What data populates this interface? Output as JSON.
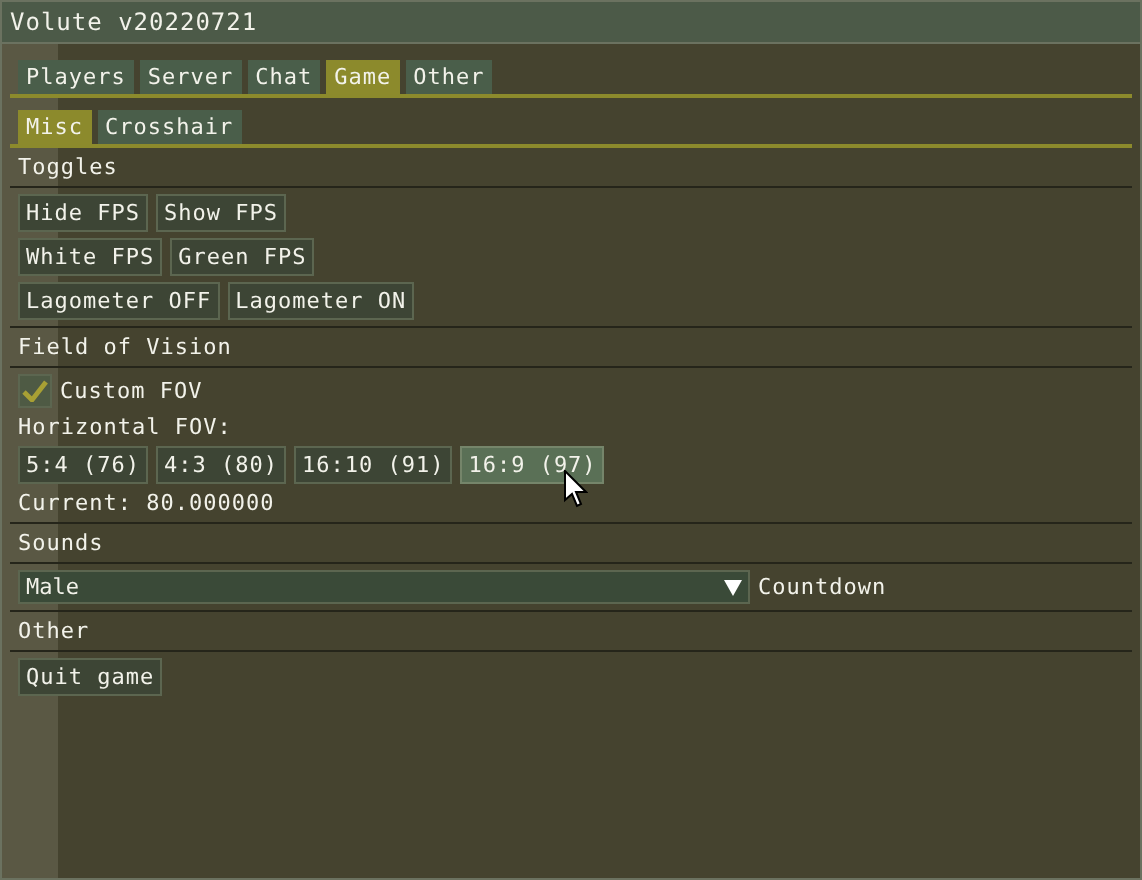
{
  "window": {
    "title": "Volute v20220721"
  },
  "tabs": [
    {
      "label": "Players",
      "selected": false
    },
    {
      "label": "Server",
      "selected": false
    },
    {
      "label": "Chat",
      "selected": false
    },
    {
      "label": "Game",
      "selected": true
    },
    {
      "label": "Other",
      "selected": false
    }
  ],
  "subtabs": [
    {
      "label": "Misc",
      "selected": true
    },
    {
      "label": "Crosshair",
      "selected": false
    }
  ],
  "toggles": {
    "heading": "Toggles",
    "rows": [
      {
        "buttons": [
          "Hide FPS",
          "Show FPS"
        ]
      },
      {
        "buttons": [
          "White FPS",
          "Green FPS"
        ]
      },
      {
        "buttons": [
          "Lagometer OFF",
          "Lagometer ON"
        ]
      }
    ]
  },
  "fov": {
    "heading": "Field of Vision",
    "checkbox": {
      "label": "Custom FOV",
      "checked": true
    },
    "label": "Horizontal FOV:",
    "buttons": [
      {
        "label": "5:4 (76)",
        "hovered": false
      },
      {
        "label": "4:3 (80)",
        "hovered": false
      },
      {
        "label": "16:10 (91)",
        "hovered": false
      },
      {
        "label": "16:9 (97)",
        "hovered": true
      }
    ],
    "current": "Current: 80.000000"
  },
  "sounds": {
    "heading": "Sounds",
    "dropdown": {
      "value": "Male"
    },
    "label": "Countdown"
  },
  "other": {
    "heading": "Other",
    "buttons": [
      "Quit game"
    ]
  }
}
